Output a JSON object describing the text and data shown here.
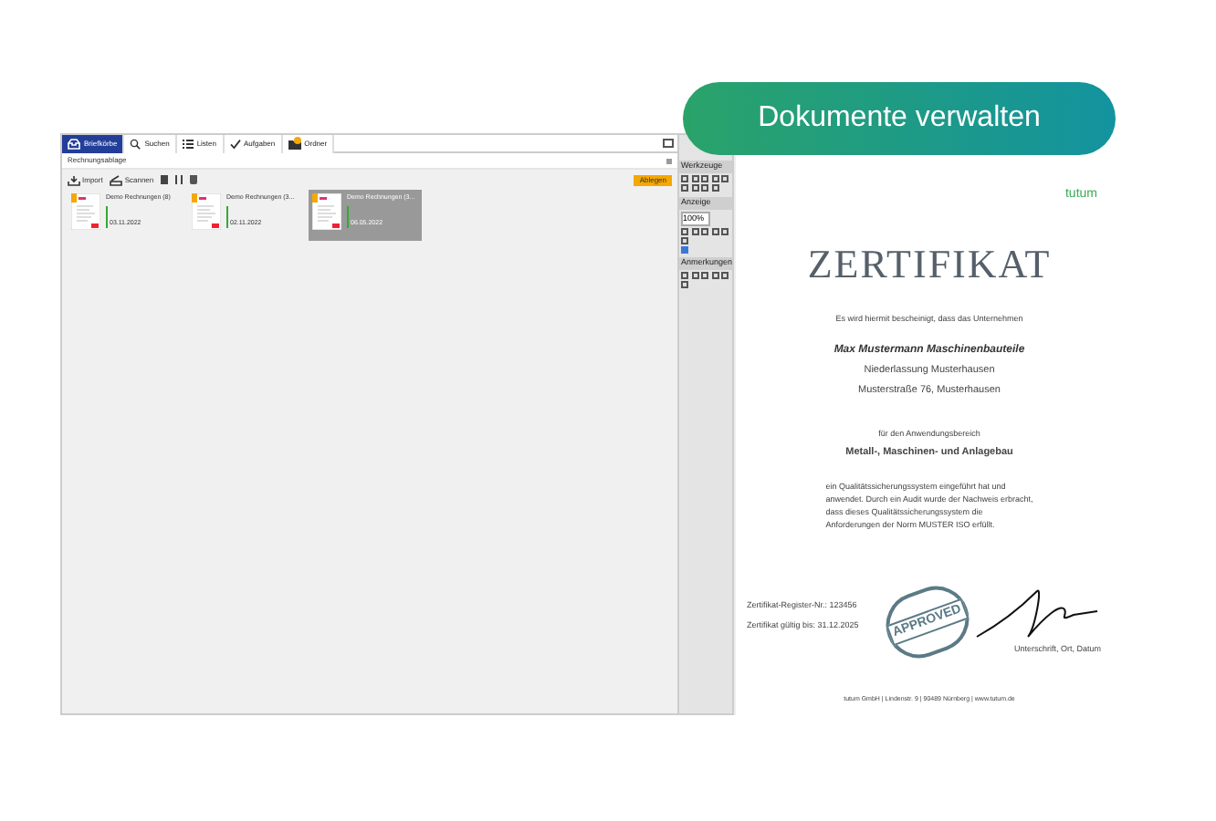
{
  "cta_button": {
    "label": "Dokumente verwalten"
  },
  "app": {
    "tabs": [
      {
        "label": "Briefkörbe",
        "selected": true
      },
      {
        "label": "Suchen",
        "selected": false
      },
      {
        "label": "Listen",
        "selected": false
      },
      {
        "label": "Aufgaben",
        "selected": false
      },
      {
        "label": "Ordner",
        "selected": false
      }
    ],
    "breadcrumb": "Rechnungsablage",
    "actions": [
      {
        "label": "Import"
      },
      {
        "label": "Scannen"
      }
    ],
    "file_button": "Ablegen",
    "documents": [
      {
        "title": "Demo Rechnungen (8)",
        "date": "03.11.2022",
        "selected": false
      },
      {
        "title": "Demo Rechnungen (3...",
        "date": "02.11.2022",
        "selected": false
      },
      {
        "title": "Demo Rechnungen (3...",
        "date": "06.05.2022",
        "selected": true
      }
    ]
  },
  "tool_panel": {
    "sections": [
      {
        "title": "Werkzeuge"
      },
      {
        "title": "Anzeige",
        "zoom": "100%",
        "checkbox": {
          "checked": true
        }
      },
      {
        "title": "Anmerkungen"
      }
    ]
  },
  "certificate": {
    "logo": "tutum",
    "title": "ZERTIFIKAT",
    "intro": "Es wird hiermit bescheinigt, dass das Unternehmen",
    "company": "Max Mustermann Maschinenbauteile",
    "address": [
      "Niederlassung Musterhausen",
      "Musterstraße 76, Musterhausen"
    ],
    "scope_intro": "für den Anwendungsbereich",
    "scope": "Metall-, Maschinen- und Anlagebau",
    "body": [
      "ein Qualitätssicherungssystem eingeführt hat und",
      "anwendet. Durch ein Audit wurde der Nachweis erbracht,",
      "dass dieses Qualitätssicherungssystem die",
      "Anforderungen der Norm MUSTER ISO erfüllt."
    ],
    "register": "Zertifikat-Register-Nr.: 123456",
    "valid": "Zertifikat gültig bis: 31.12.2025",
    "stamp": "APPROVED",
    "signature_label": "Unterschrift, Ort, Datum",
    "footer": "tutum GmbH | Lindenstr. 9 | 90489 Nürnberg | www.tutum.de"
  }
}
